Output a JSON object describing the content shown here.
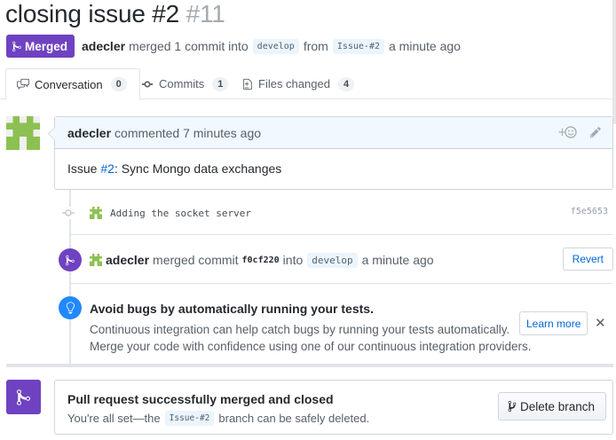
{
  "header": {
    "title": "closing issue #2",
    "number": "#11"
  },
  "meta": {
    "status_label": "Merged",
    "author": "adecler",
    "action": "merged 1 commit into",
    "base_branch": "develop",
    "from_word": "from",
    "head_branch": "Issue-#2",
    "time": "a minute ago"
  },
  "tabs": [
    {
      "label": "Conversation",
      "count": "0",
      "icon": "comment-discussion-icon",
      "selected": true
    },
    {
      "label": "Commits",
      "count": "1",
      "icon": "git-commit-icon",
      "selected": false
    },
    {
      "label": "Files changed",
      "count": "4",
      "icon": "file-diff-icon",
      "selected": false
    }
  ],
  "comment": {
    "author": "adecler",
    "action": "commented 7 minutes ago",
    "body_prefix": "Issue ",
    "issue_link": "#2",
    "body_suffix": ": Sync Mongo data exchanges",
    "actions": [
      "add-reaction-icon",
      "pencil-icon"
    ],
    "avatar_color": "#8cc152"
  },
  "commit": {
    "message": "Adding the socket server",
    "sha": "f5e5653"
  },
  "merge_event": {
    "author": "adecler",
    "action": "merged commit",
    "sha": "f0cf220",
    "into": "into",
    "branch": "develop",
    "time": "a minute ago",
    "revert_label": "Revert"
  },
  "ci_hint": {
    "title": "Avoid bugs by automatically running your tests.",
    "line1": "Continuous integration can help catch bugs by running your tests automatically.",
    "line2": "Merge your code with confidence using one of our continuous integration providers.",
    "learn_more_label": "Learn more",
    "close_label": "✕"
  },
  "merge_status": {
    "title": "Pull request successfully merged and closed",
    "desc_prefix": "You're all set—the",
    "branch": "Issue-#2",
    "desc_suffix": "branch can be safely deleted.",
    "delete_label": "Delete branch"
  },
  "colors": {
    "merged_purple": "#6f42c1",
    "link_blue": "#0366d6",
    "info_blue": "#2188ff"
  }
}
